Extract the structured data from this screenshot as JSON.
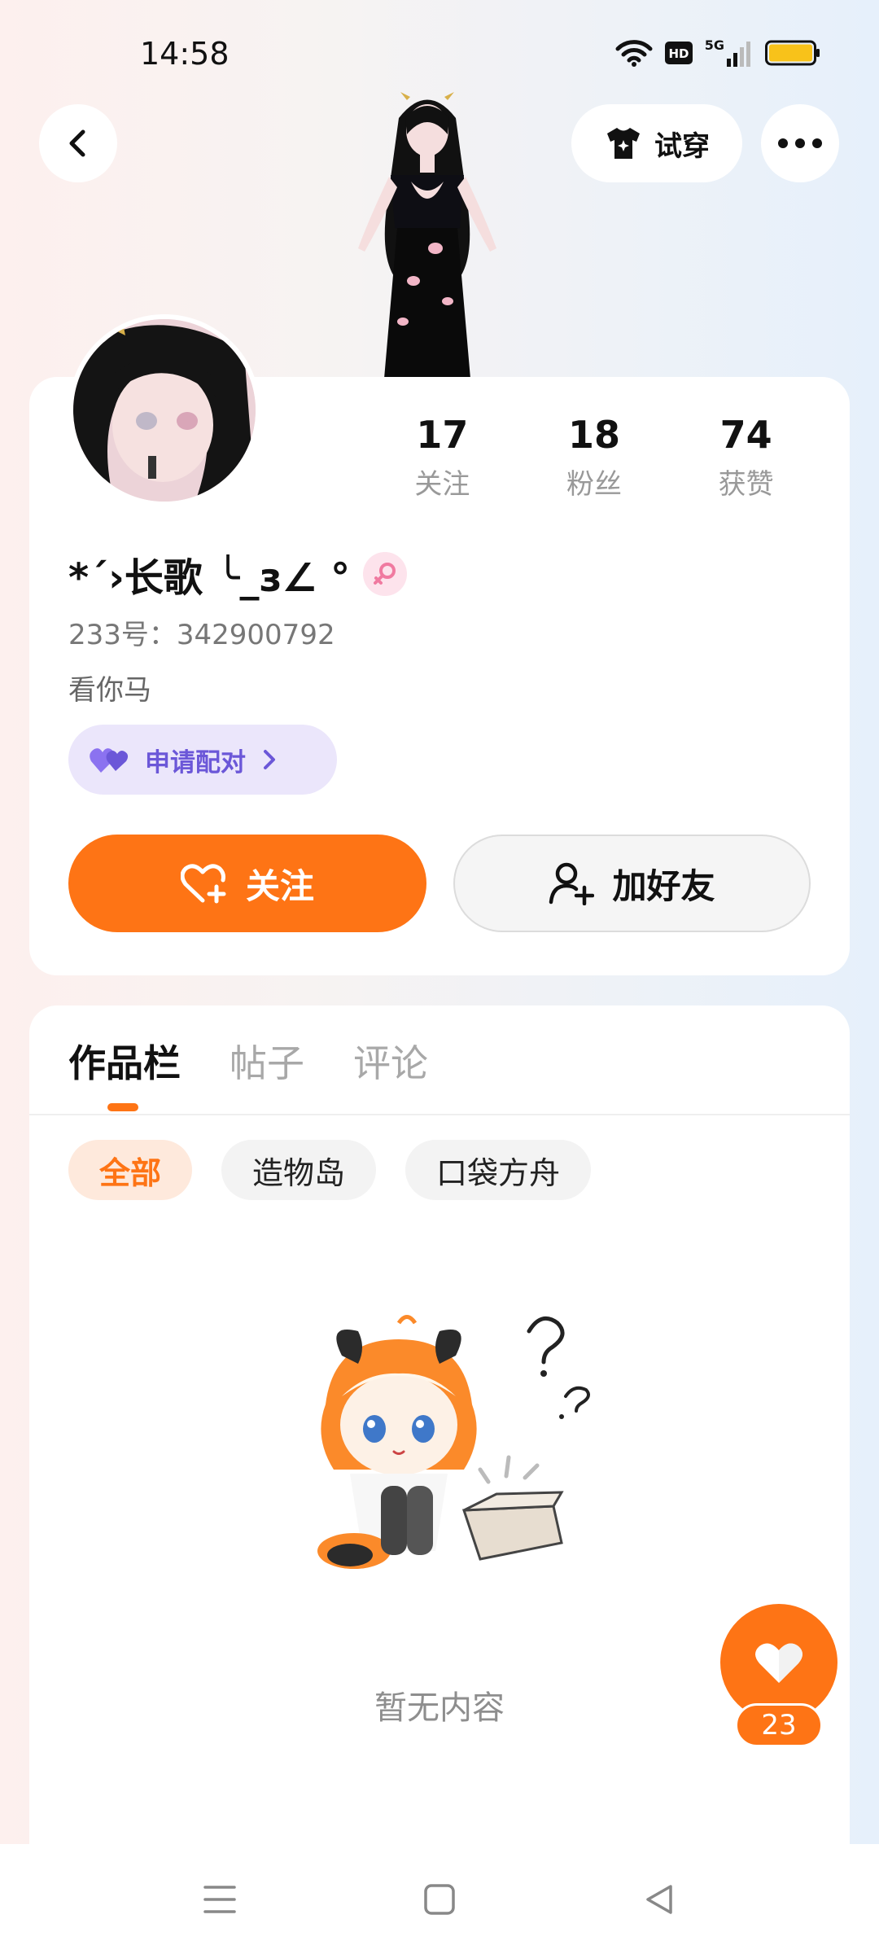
{
  "status_bar": {
    "time": "14:58",
    "network_label": "5G"
  },
  "header": {
    "tryon_label": "试穿"
  },
  "profile": {
    "stats": [
      {
        "value": "17",
        "label": "关注"
      },
      {
        "value": "18",
        "label": "粉丝"
      },
      {
        "value": "74",
        "label": "获赞"
      }
    ],
    "nickname": "*´›长歌 ╰_з∠ °",
    "uid": "233号：342900792",
    "bio": "看你马",
    "pair_label": "申请配对",
    "follow_label": "关注",
    "add_friend_label": "加好友"
  },
  "works": {
    "tabs": [
      "作品栏",
      "帖子",
      "评论"
    ],
    "chips": [
      "全部",
      "造物岛",
      "口袋方舟"
    ],
    "empty_text": "暂无内容"
  },
  "like_fab": {
    "count": "23"
  },
  "colors": {
    "accent": "#fe7415",
    "pair": "#6b57d8"
  }
}
